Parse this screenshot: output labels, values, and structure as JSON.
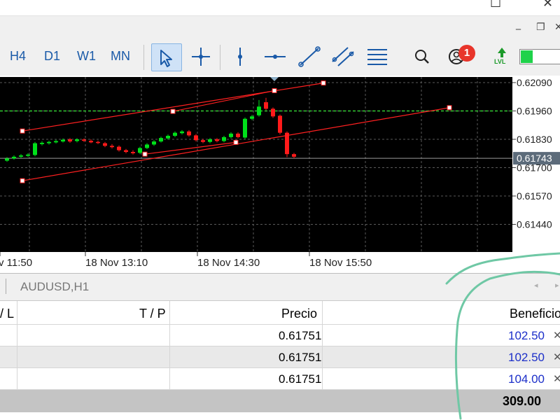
{
  "toolbar": {
    "timeframes": [
      "H4",
      "D1",
      "W1",
      "MN"
    ],
    "notifications_count": "1",
    "lvl_label": "LVL",
    "level_fill": 0.3
  },
  "chart": {
    "y_axis_labels": [
      "0.62090",
      "0.61960",
      "0.61830",
      "0.61700",
      "0.61570",
      "0.61440"
    ],
    "current_price": "0.61743",
    "x_axis_labels": [
      "v 11:50",
      "18 Nov 13:10",
      "18 Nov 14:30",
      "18 Nov 15:50"
    ],
    "symbol_tab": "AUDUSD,H1"
  },
  "table": {
    "headers": {
      "sl": "/ L",
      "tp": "T / P",
      "price": "Precio",
      "profit": "Beneficio"
    },
    "rows": [
      {
        "price": "0.61751",
        "profit": "102.50"
      },
      {
        "price": "0.61751",
        "profit": "102.50"
      },
      {
        "price": "0.61751",
        "profit": "104.00"
      }
    ],
    "total_profit": "309.00",
    "close_glyph": "✕"
  },
  "colors": {
    "chart_bg": "#000000",
    "grid": "#5a5a5a",
    "bull_candle": "#00e01a",
    "bear_candle": "#ff1a1a",
    "channel_line": "#ff2020",
    "price_level": "#33cc33",
    "profit_text": "#1c2fc9",
    "annotation": "#6fc8a5"
  }
}
